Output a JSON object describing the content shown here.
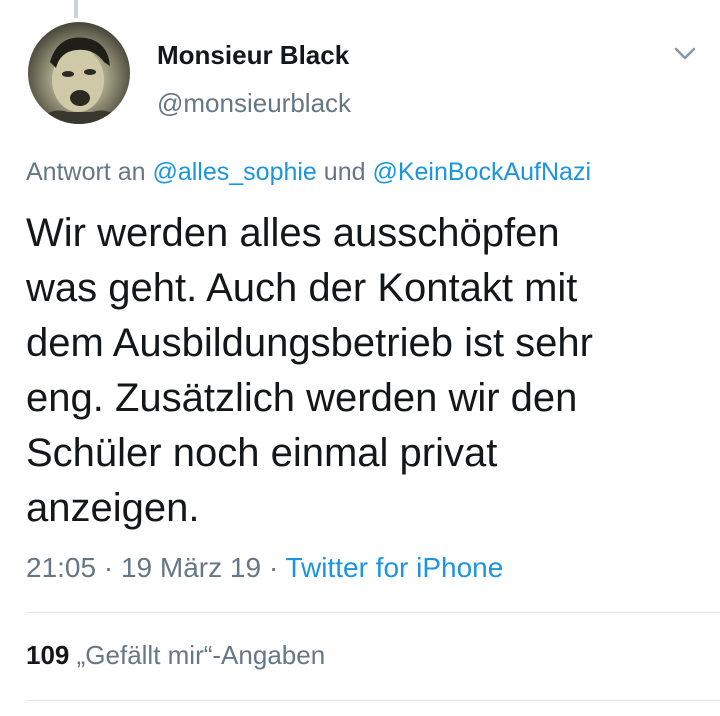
{
  "author": {
    "display_name": "Monsieur Black",
    "handle": "@monsieurblack"
  },
  "reply": {
    "prefix": "Antwort an",
    "mention_1": "@alles_sophie",
    "conjunction": "und",
    "mention_2": "@KeinBockAufNazi"
  },
  "tweet": {
    "lines": [
      "Wir werden alles ausschöpfen",
      "was geht. Auch der Kontakt mit",
      "dem Ausbildungsbetrieb ist sehr",
      "eng. Zusätzlich werden wir den",
      "Schüler noch einmal privat",
      "anzeigen."
    ]
  },
  "meta": {
    "time": "21:05",
    "date": "19 März 19",
    "separator": "·",
    "source": "Twitter for iPhone"
  },
  "stats": {
    "likes_count": "109",
    "likes_label": "„Gefällt mir“-Angaben"
  },
  "colors": {
    "link": "#1b95e0",
    "secondary_text": "#657786",
    "primary_text": "#14171a",
    "divider": "#e1e8ed"
  },
  "icons": {
    "menu": "chevron-down-icon"
  }
}
